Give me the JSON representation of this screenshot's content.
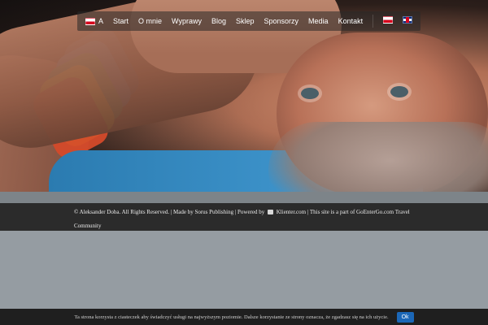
{
  "nav": {
    "home_label": "A",
    "items": [
      "Start",
      "O mnie",
      "Wyprawy",
      "Blog",
      "Sklep",
      "Sponsorzy",
      "Media",
      "Kontakt"
    ],
    "lang_flags": [
      {
        "name": "polish-flag-icon"
      },
      {
        "name": "english-flag-icon"
      }
    ]
  },
  "footer": {
    "text_part1": "© Aleksander Doba. All Rights Reserved. | Made by Sorus Publishing | Powered by ",
    "klienter": "Klienter.com",
    "text_part2": " | This site is a part of GoEnterGo.com Travel Community"
  },
  "cookie": {
    "message": "Ta strona korzysta z ciasteczek aby świadczyć usługi na najwyższym poziomie. Dalsze korzystanie ze strony oznacza, że zgadzasz się na ich użycie.",
    "ok_label": "Ok"
  }
}
